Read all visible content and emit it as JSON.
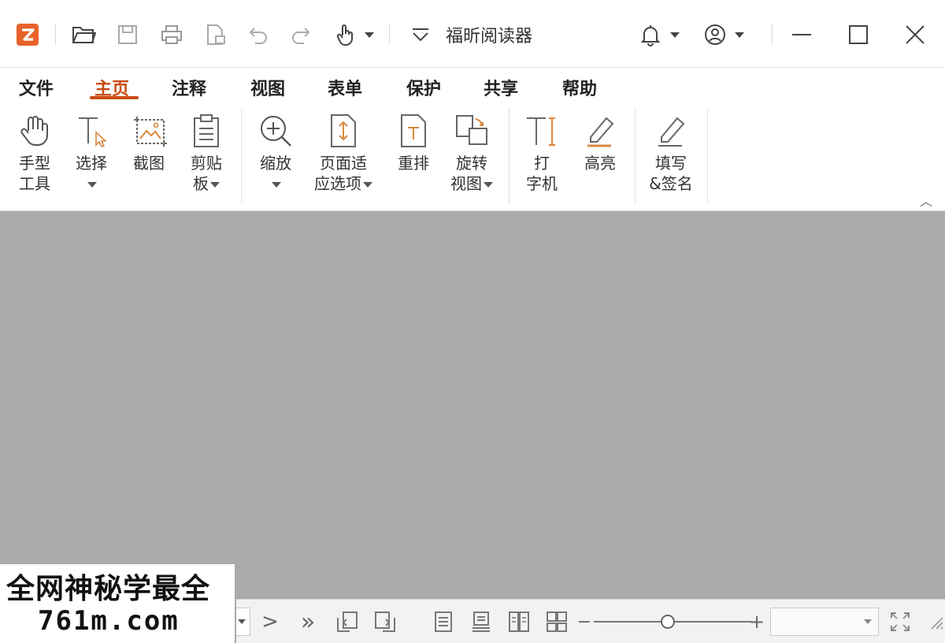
{
  "titlebar": {
    "app_title": "福昕阅读器",
    "icons": [
      "app-logo-icon",
      "open-folder-icon",
      "save-icon",
      "print-icon",
      "create-pdf-icon",
      "undo-icon",
      "redo-icon",
      "hand-tool-icon",
      "quick-access-dropdown-icon",
      "bell-icon",
      "account-icon",
      "minimize-icon",
      "maximize-icon",
      "close-icon"
    ]
  },
  "menu": {
    "tabs": [
      "文件",
      "主页",
      "注释",
      "视图",
      "表单",
      "保护",
      "共享",
      "帮助"
    ],
    "active": "主页"
  },
  "ribbon": {
    "hand": {
      "line1": "手型",
      "line2": "工具"
    },
    "select": {
      "line1": "选择"
    },
    "snapshot": {
      "line1": "截图"
    },
    "clipboard": {
      "line1": "剪贴",
      "line2": "板"
    },
    "zoom": {
      "line1": "缩放"
    },
    "fit": {
      "line1": "页面适",
      "line2": "应选项"
    },
    "reflow": {
      "line1": "重排"
    },
    "rotate": {
      "line1": "旋转",
      "line2": "视图"
    },
    "typewriter": {
      "line1": "打",
      "line2": "字机"
    },
    "highlight": {
      "line1": "高亮"
    },
    "fillsign": {
      "line1": "填写",
      "line2": "&签名"
    },
    "collapse_glyph": "︿"
  },
  "statusbar": {
    "next_glyph": ">",
    "last_glyph": "»",
    "zoom_minus": "−",
    "zoom_plus": "+",
    "zoom_slider_fraction": 0.47
  },
  "watermark": {
    "line1": "全网神秘学最全",
    "line2": "761m.com"
  },
  "colors": {
    "accent": "#c84b14",
    "doc_background": "#ababab"
  }
}
